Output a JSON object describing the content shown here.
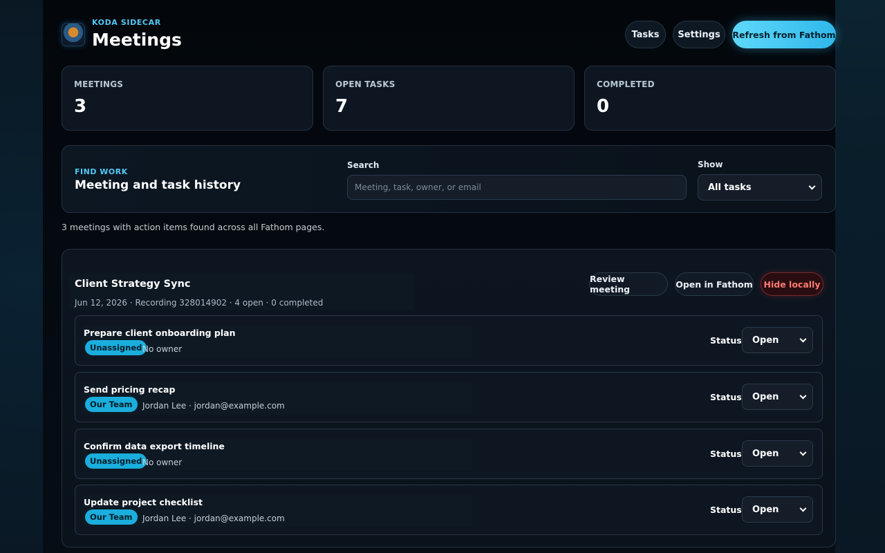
{
  "header": {
    "brand": "KODA SIDECAR",
    "title": "Meetings",
    "buttons": {
      "tasks": "Tasks",
      "settings": "Settings",
      "refresh": "Refresh from Fathom"
    }
  },
  "stats": [
    {
      "label": "MEETINGS",
      "value": "3"
    },
    {
      "label": "OPEN TASKS",
      "value": "7"
    },
    {
      "label": "COMPLETED",
      "value": "0"
    }
  ],
  "find": {
    "kicker": "FIND WORK",
    "heading": "Meeting and task history",
    "search_label": "Search",
    "search_placeholder": "Meeting, task, owner, or email",
    "show_label": "Show",
    "show_value": "All tasks"
  },
  "summary": "3 meetings with action items found across all Fathom pages.",
  "meeting": {
    "title": "Client Strategy Sync",
    "meta": "Jun 12, 2026 · Recording 328014902 · 4 open · 0 completed",
    "buttons": {
      "review": "Review meeting",
      "open": "Open in Fathom",
      "hide": "Hide locally"
    },
    "status_label": "Status",
    "tasks": [
      {
        "title": "Prepare client onboarding plan",
        "badge": "Unassigned",
        "owner": "No owner",
        "status": "Open"
      },
      {
        "title": "Send pricing recap",
        "badge": "Our Team",
        "owner": "Jordan Lee · jordan@example.com",
        "status": "Open"
      },
      {
        "title": "Confirm data export timeline",
        "badge": "Unassigned",
        "owner": "No owner",
        "status": "Open"
      },
      {
        "title": "Update project checklist",
        "badge": "Our Team",
        "owner": "Jordan Lee · jordan@example.com",
        "status": "Open"
      }
    ]
  },
  "colors": {
    "accent": "#55c8f5",
    "badge": "#1aaedd",
    "danger": "#ff7a74",
    "background": "#050a11"
  }
}
